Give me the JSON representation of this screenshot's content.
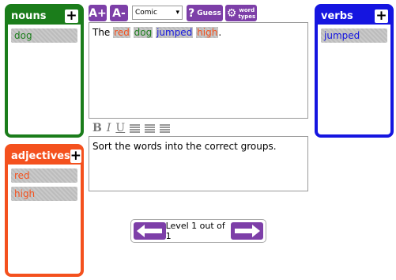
{
  "panels": {
    "nouns": {
      "title": "nouns",
      "items": [
        "dog"
      ]
    },
    "adjectives": {
      "title": "adjectives",
      "items": [
        "red",
        "high"
      ]
    },
    "verbs": {
      "title": "verbs",
      "items": [
        "jumped"
      ]
    }
  },
  "toolbar": {
    "font_up": "A+",
    "font_down": "A-",
    "font_select_value": "Comic",
    "guess_label": "Guess",
    "types_label_1": "word",
    "types_label_2": "types"
  },
  "sentence": {
    "w1": "The",
    "w2": "red",
    "w3": "dog",
    "w4": "jumped",
    "w5": "high",
    "w6": "."
  },
  "instructions": "Sort the words into the correct groups.",
  "level": {
    "text": "Level 1 out of 1"
  },
  "colors": {
    "noun": "#1b7d1b",
    "adjective": "#f4511e",
    "verb": "#1515e0",
    "accent": "#7d3fa8"
  }
}
